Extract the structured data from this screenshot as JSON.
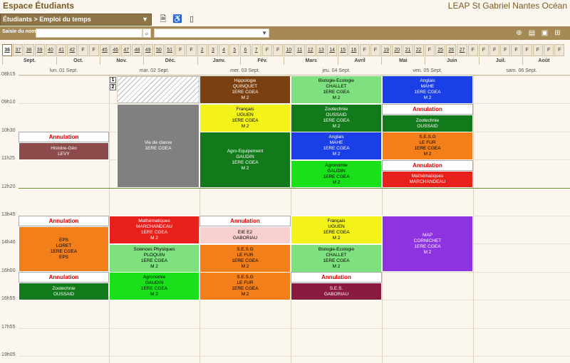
{
  "header": {
    "app_title": "Espace Étudiants",
    "school": "LEAP St Gabriel Nantes Océan"
  },
  "nav": {
    "breadcrumb": "Étudiants > Emploi du temps",
    "icons": [
      "pdf-icon",
      "accessibility-icon",
      "mobile-icon"
    ]
  },
  "search": {
    "label": "Saisie du nom",
    "value": "",
    "select_value": "",
    "icons": [
      "zoom-icon",
      "print-icon",
      "week-view-icon",
      "grid-view-icon"
    ]
  },
  "weeks": [
    "36",
    "37",
    "38",
    "39",
    "40",
    "41",
    "42",
    "F",
    "F",
    "45",
    "46",
    "47",
    "48",
    "49",
    "50",
    "51",
    "F",
    "F",
    "2",
    "3",
    "4",
    "5",
    "6",
    "7",
    "F",
    "F",
    "10",
    "11",
    "12",
    "13",
    "14",
    "15",
    "16",
    "F",
    "F",
    "19",
    "20",
    "21",
    "22",
    "F",
    "25",
    "26",
    "27",
    "F",
    "F",
    "F",
    "F",
    "F",
    "F",
    "F",
    "F",
    "F"
  ],
  "months": [
    "Sept.",
    "Oct.",
    "Nov.",
    "Déc.",
    "Janv.",
    "Fév.",
    "Mars",
    "Avril",
    "Mai",
    "Juin",
    "Juil.",
    "Août"
  ],
  "days": [
    "lun. 01 Sept.",
    "mar. 02 Sept.",
    "mer. 03 Sept.",
    "jeu. 04 Sept.",
    "ven. 05 Sept.",
    "sam. 06 Sept."
  ],
  "times": [
    "08h15",
    "09h10",
    "10h30",
    "11h25",
    "12h20",
    "13h45",
    "14h40",
    "16h00",
    "16h55",
    "17h55",
    "19h05"
  ],
  "page_tabs": [
    "1",
    "2"
  ],
  "annulation_label": "Annulation",
  "colors": {
    "brand": "#8f7447",
    "cancel": "#d20000",
    "lunch_line": "#6e8f3c"
  },
  "events": [
    {
      "day": 0,
      "lines": [
        "Histoire-Géo",
        "LEVY"
      ],
      "bg": "#8d4b4b",
      "color": "#fff",
      "cancelled": true
    },
    {
      "day": 0,
      "lines": [
        "EPS",
        "LORET",
        "1ERE CGEA",
        "EPS"
      ],
      "bg": "#f27f19",
      "color": "#000",
      "cancelled": true
    },
    {
      "day": 0,
      "lines": [
        "Zootechnie",
        "OUSSAID"
      ],
      "bg": "#127a1b",
      "color": "#fff",
      "cancelled": true
    },
    {
      "day": 1,
      "lines": [
        "Vie de classe",
        "1ERE CGEA"
      ],
      "bg": "#808080",
      "color": "#fff",
      "cancelled": false
    },
    {
      "day": 1,
      "lines": [
        "Mathématiques",
        "MARCHANDEAU",
        "1ERE CGEA",
        "M 2"
      ],
      "bg": "#e8201b",
      "color": "#fff",
      "cancelled": false
    },
    {
      "day": 1,
      "lines": [
        "Sciences Physiques",
        "PLOQUIN",
        "1ERE CGEA",
        "M 2"
      ],
      "bg": "#7fe07f",
      "color": "#000",
      "cancelled": false
    },
    {
      "day": 1,
      "lines": [
        "Agronomie",
        "GAUDIN",
        "1ERE CGEA",
        "M 2"
      ],
      "bg": "#19e019",
      "color": "#000",
      "cancelled": false
    },
    {
      "day": 2,
      "lines": [
        "Hippologie",
        "QUINQUET",
        "1ERE CGEA",
        "M 2"
      ],
      "bg": "#7a4010",
      "color": "#fff",
      "cancelled": false
    },
    {
      "day": 2,
      "lines": [
        "Français",
        "UGUEN",
        "1ERE CGEA",
        "M 2"
      ],
      "bg": "#f3f319",
      "color": "#000",
      "cancelled": false
    },
    {
      "day": 2,
      "lines": [
        "Agro-Equipement",
        "GAUDIN",
        "1ERE CGEA",
        "M 2"
      ],
      "bg": "#127a1b",
      "color": "#fff",
      "cancelled": false
    },
    {
      "day": 2,
      "lines": [
        "EIE E2",
        "GABORIAU"
      ],
      "bg": "#f8d0d0",
      "color": "#000",
      "cancelled": true
    },
    {
      "day": 2,
      "lines": [
        "S.E.S.G",
        "LE FUR",
        "1ERE CGEA",
        "M 2"
      ],
      "bg": "#f27f19",
      "color": "#000",
      "cancelled": false
    },
    {
      "day": 2,
      "lines": [
        "S.E.S.G",
        "LE FUR",
        "1ERE CGEA",
        "M 2"
      ],
      "bg": "#f27f19",
      "color": "#000",
      "cancelled": false
    },
    {
      "day": 3,
      "lines": [
        "Biologie-Ecologie",
        "CHALLET",
        "1ERE CGEA",
        "M 2"
      ],
      "bg": "#7fe07f",
      "color": "#000",
      "cancelled": false
    },
    {
      "day": 3,
      "lines": [
        "Zootechnie",
        "OUSSAID",
        "1ERE CGEA",
        "M 2"
      ],
      "bg": "#127a1b",
      "color": "#fff",
      "cancelled": false
    },
    {
      "day": 3,
      "lines": [
        "Anglais",
        "MAHE",
        "1ERE CGEA",
        "M 2"
      ],
      "bg": "#1a3fe6",
      "color": "#fff",
      "cancelled": false
    },
    {
      "day": 3,
      "lines": [
        "Agronomie",
        "GAUDIN",
        "1ERE CGEA",
        "M 2"
      ],
      "bg": "#19e019",
      "color": "#000",
      "cancelled": false
    },
    {
      "day": 3,
      "lines": [
        "Français",
        "UGUEN",
        "1ERE CGEA",
        "M 2"
      ],
      "bg": "#f3f319",
      "color": "#000",
      "cancelled": false
    },
    {
      "day": 3,
      "lines": [
        "Biologie-Ecologie",
        "CHALLET",
        "1ERE CGEA",
        "M 2"
      ],
      "bg": "#7fe07f",
      "color": "#000",
      "cancelled": false
    },
    {
      "day": 3,
      "lines": [
        "S.E.S.",
        "GABORIAU"
      ],
      "bg": "#8a1a40",
      "color": "#fff",
      "cancelled": true
    },
    {
      "day": 4,
      "lines": [
        "Anglais",
        "MAHE",
        "1ERE CGEA",
        "M 2"
      ],
      "bg": "#1a3fe6",
      "color": "#fff",
      "cancelled": false
    },
    {
      "day": 4,
      "lines": [
        "Zootechnie",
        "OUSSAID"
      ],
      "bg": "#127a1b",
      "color": "#fff",
      "cancelled": true
    },
    {
      "day": 4,
      "lines": [
        "S.E.S.G",
        "LE FUR",
        "1ERE CGEA",
        "M 2"
      ],
      "bg": "#f27f19",
      "color": "#000",
      "cancelled": false
    },
    {
      "day": 4,
      "lines": [
        "Mathématiques",
        "MARCHANDEAU"
      ],
      "bg": "#e8201b",
      "color": "#fff",
      "cancelled": true
    },
    {
      "day": 4,
      "lines": [
        "MAP",
        "CORNICHET",
        "1ERE CGEA",
        "M 2"
      ],
      "bg": "#8e33e0",
      "color": "#fff",
      "cancelled": false
    }
  ]
}
